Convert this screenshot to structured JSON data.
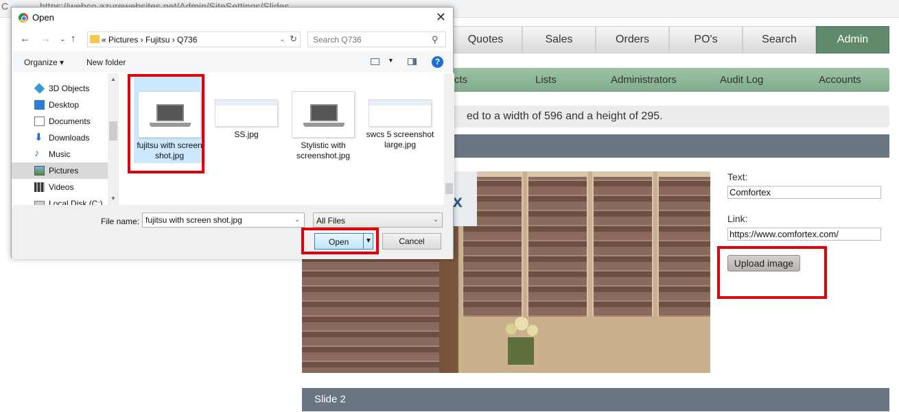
{
  "browser": {
    "url": "https://webco.azurewebsites.net/Admin/SiteSettings/Slides"
  },
  "topnav": {
    "tabs": [
      "Quotes",
      "Sales",
      "Orders",
      "PO's",
      "Search",
      "Admin"
    ]
  },
  "subnav": {
    "items": [
      "cts",
      "Lists",
      "Administrators",
      "Audit Log",
      "Accounts"
    ]
  },
  "notice": {
    "text": "ed to a width of 596 and a height of 295."
  },
  "slide1": {
    "image_logo_text": "ex",
    "text_label": "Text:",
    "text_value": "Comfortex",
    "link_label": "Link:",
    "link_value": "https://www.comfortex.com/",
    "upload_button": "Upload image"
  },
  "slide2": {
    "label": "Slide 2"
  },
  "dialog": {
    "title": "Open",
    "breadcrumb": "«  Pictures  ›  Fujitsu  ›  Q736",
    "search_placeholder": "Search Q736",
    "organize": "Organize ▾",
    "new_folder": "New folder",
    "nav_items": [
      "3D Objects",
      "Desktop",
      "Documents",
      "Downloads",
      "Music",
      "Pictures",
      "Videos",
      "Local Disk (C:)"
    ],
    "files": [
      "fujitsu with screen shot.jpg",
      "SS.jpg",
      "Stylistic with screenshot.jpg",
      "swcs 5 screenshot large.jpg"
    ],
    "filename_label": "File name:",
    "filename_value": "fujitsu with screen shot.jpg",
    "filetype": "All Files",
    "open_button": "Open",
    "cancel_button": "Cancel"
  },
  "colors": {
    "accent_red": "#e0000b",
    "admin_green": "#5f8a6c",
    "subnav_green": "#8fb89a",
    "slide_bar": "#6a7782"
  }
}
